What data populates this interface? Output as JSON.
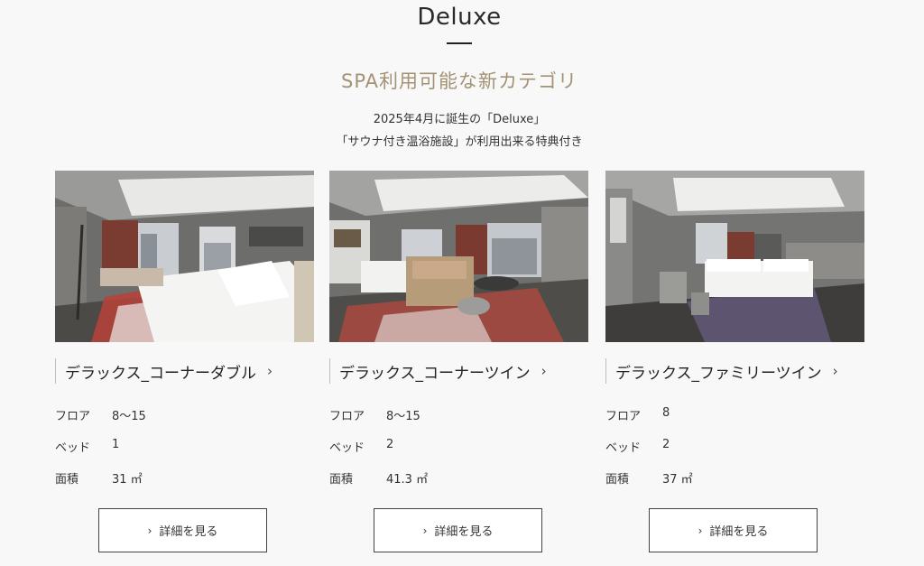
{
  "section": {
    "title": "Deluxe",
    "subtitle": "SPA利用可能な新カテゴリ",
    "desc_line1": "2025年4月に誕生の「Deluxe」",
    "desc_line2": "「サウナ付き温浴施設」が利用出来る特典付き"
  },
  "spec_labels": {
    "floor": "フロア",
    "bed": "ベッド",
    "area": "面積"
  },
  "rooms": [
    {
      "name": "デラックス_コーナーダブル",
      "floor": "8〜15",
      "bed": "1",
      "area": "31 ㎡",
      "button": "詳細を見る",
      "chevron_icon": "chevron-right-icon"
    },
    {
      "name": "デラックス_コーナーツイン",
      "floor": "8〜15",
      "bed": "2",
      "area": "41.3 ㎡",
      "button": "詳細を見る",
      "chevron_icon": "chevron-right-icon"
    },
    {
      "name": "デラックス_ファミリーツイン",
      "floor": "8",
      "bed": "2",
      "area": "37 ㎡",
      "button": "詳細を見る",
      "chevron_icon": "chevron-right-icon"
    }
  ],
  "colors": {
    "background": "#f8f8f8",
    "subtitle_gold": "#a39273",
    "text": "#333333"
  }
}
